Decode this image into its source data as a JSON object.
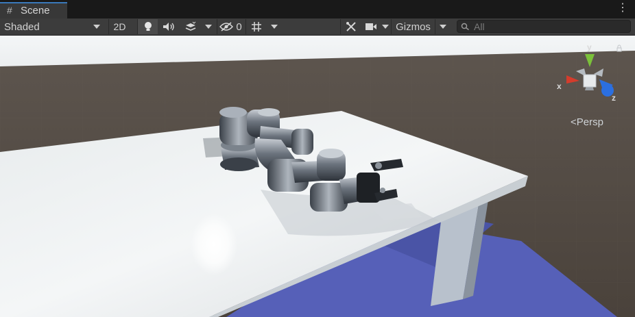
{
  "tab": {
    "icon": "hash-icon",
    "title": "Scene"
  },
  "tab_menu": {
    "icon": "kebab-menu-icon",
    "glyph": "⋮"
  },
  "toolbar": {
    "draw_mode": "Shaded",
    "mode_2d": "2D",
    "lighting_icon": "lightbulb-icon",
    "audio_icon": "speaker-icon",
    "effects_icon": "layers-icon",
    "hidden_icon": "eye-slash-icon",
    "hidden_count": "0",
    "grid_icon": "grid-icon",
    "tools_icon": "wrench-icon",
    "camera_icon": "camera-icon",
    "gizmos_label": "Gizmos",
    "search_placeholder": "All"
  },
  "gizmo": {
    "x_label": "x",
    "y_label": "y",
    "z_label": "z",
    "projection": "<Persp",
    "colors": {
      "x": "#d43c2c",
      "y": "#7bc13a",
      "z": "#2b6fe0"
    }
  }
}
